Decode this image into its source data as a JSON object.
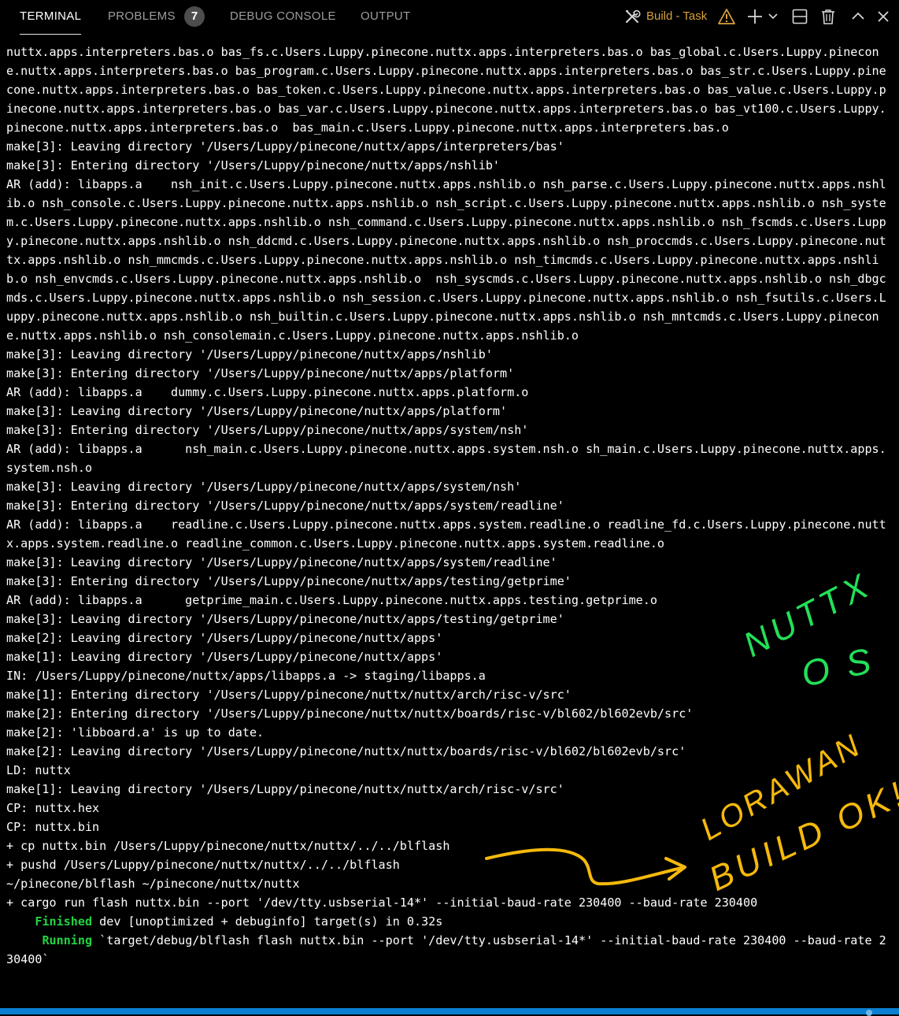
{
  "tabs": [
    {
      "label": "TERMINAL",
      "active": true
    },
    {
      "label": "PROBLEMS"
    },
    {
      "label": "DEBUG CONSOLE"
    },
    {
      "label": "OUTPUT"
    }
  ],
  "problems_count": "7",
  "task_label": "Build - Task",
  "icons": [
    "tools-icon",
    "warning-icon",
    "plus-icon",
    "chevron-down-icon",
    "split-icon",
    "trash-icon",
    "chevron-up-icon",
    "close-icon"
  ],
  "colors": {
    "background": "#000000",
    "text": "#ffffff",
    "tab_inactive": "#9d9d9d",
    "task": "#d6a23a",
    "highlight": "#22d342",
    "annotation_green": "#23e058",
    "annotation_yellow": "#f5b90c",
    "statusbar": "#0b7fd1"
  },
  "terminal": {
    "lines": [
      "nuttx.apps.interpreters.bas.o bas_fs.c.Users.Luppy.pinecone.nuttx.apps.interpreters.bas.o bas_global.c.Users.Luppy.pinecone.nuttx.apps.interpreters.bas.o bas_program.c.Users.Luppy.pinecone.nuttx.apps.interpreters.bas.o bas_str.c.Users.Luppy.pinecone.nuttx.apps.interpreters.bas.o bas_token.c.Users.Luppy.pinecone.nuttx.apps.interpreters.bas.o bas_value.c.Users.Luppy.pinecone.nuttx.apps.interpreters.bas.o bas_var.c.Users.Luppy.pinecone.nuttx.apps.interpreters.bas.o bas_vt100.c.Users.Luppy.pinecone.nuttx.apps.interpreters.bas.o  bas_main.c.Users.Luppy.pinecone.nuttx.apps.interpreters.bas.o",
      "make[3]: Leaving directory '/Users/Luppy/pinecone/nuttx/apps/interpreters/bas'",
      "make[3]: Entering directory '/Users/Luppy/pinecone/nuttx/apps/nshlib'",
      "AR (add): libapps.a    nsh_init.c.Users.Luppy.pinecone.nuttx.apps.nshlib.o nsh_parse.c.Users.Luppy.pinecone.nuttx.apps.nshlib.o nsh_console.c.Users.Luppy.pinecone.nuttx.apps.nshlib.o nsh_script.c.Users.Luppy.pinecone.nuttx.apps.nshlib.o nsh_system.c.Users.Luppy.pinecone.nuttx.apps.nshlib.o nsh_command.c.Users.Luppy.pinecone.nuttx.apps.nshlib.o nsh_fscmds.c.Users.Luppy.pinecone.nuttx.apps.nshlib.o nsh_ddcmd.c.Users.Luppy.pinecone.nuttx.apps.nshlib.o nsh_proccmds.c.Users.Luppy.pinecone.nuttx.apps.nshlib.o nsh_mmcmds.c.Users.Luppy.pinecone.nuttx.apps.nshlib.o nsh_timcmds.c.Users.Luppy.pinecone.nuttx.apps.nshlib.o nsh_envcmds.c.Users.Luppy.pinecone.nuttx.apps.nshlib.o  nsh_syscmds.c.Users.Luppy.pinecone.nuttx.apps.nshlib.o nsh_dbgcmds.c.Users.Luppy.pinecone.nuttx.apps.nshlib.o nsh_session.c.Users.Luppy.pinecone.nuttx.apps.nshlib.o nsh_fsutils.c.Users.Luppy.pinecone.nuttx.apps.nshlib.o nsh_builtin.c.Users.Luppy.pinecone.nuttx.apps.nshlib.o nsh_mntcmds.c.Users.Luppy.pinecone.nuttx.apps.nshlib.o nsh_consolemain.c.Users.Luppy.pinecone.nuttx.apps.nshlib.o",
      "make[3]: Leaving directory '/Users/Luppy/pinecone/nuttx/apps/nshlib'",
      "make[3]: Entering directory '/Users/Luppy/pinecone/nuttx/apps/platform'",
      "AR (add): libapps.a    dummy.c.Users.Luppy.pinecone.nuttx.apps.platform.o",
      "make[3]: Leaving directory '/Users/Luppy/pinecone/nuttx/apps/platform'",
      "make[3]: Entering directory '/Users/Luppy/pinecone/nuttx/apps/system/nsh'",
      "AR (add): libapps.a      nsh_main.c.Users.Luppy.pinecone.nuttx.apps.system.nsh.o sh_main.c.Users.Luppy.pinecone.nuttx.apps.system.nsh.o",
      "make[3]: Leaving directory '/Users/Luppy/pinecone/nuttx/apps/system/nsh'",
      "make[3]: Entering directory '/Users/Luppy/pinecone/nuttx/apps/system/readline'",
      "AR (add): libapps.a    readline.c.Users.Luppy.pinecone.nuttx.apps.system.readline.o readline_fd.c.Users.Luppy.pinecone.nuttx.apps.system.readline.o readline_common.c.Users.Luppy.pinecone.nuttx.apps.system.readline.o",
      "make[3]: Leaving directory '/Users/Luppy/pinecone/nuttx/apps/system/readline'",
      "make[3]: Entering directory '/Users/Luppy/pinecone/nuttx/apps/testing/getprime'",
      "AR (add): libapps.a      getprime_main.c.Users.Luppy.pinecone.nuttx.apps.testing.getprime.o",
      "make[3]: Leaving directory '/Users/Luppy/pinecone/nuttx/apps/testing/getprime'",
      "make[2]: Leaving directory '/Users/Luppy/pinecone/nuttx/apps'",
      "make[1]: Leaving directory '/Users/Luppy/pinecone/nuttx/apps'",
      "IN: /Users/Luppy/pinecone/nuttx/apps/libapps.a -> staging/libapps.a",
      "make[1]: Entering directory '/Users/Luppy/pinecone/nuttx/nuttx/arch/risc-v/src'",
      "make[2]: Entering directory '/Users/Luppy/pinecone/nuttx/nuttx/boards/risc-v/bl602/bl602evb/src'",
      "make[2]: 'libboard.a' is up to date.",
      "make[2]: Leaving directory '/Users/Luppy/pinecone/nuttx/nuttx/boards/risc-v/bl602/bl602evb/src'",
      "LD: nuttx",
      "make[1]: Leaving directory '/Users/Luppy/pinecone/nuttx/nuttx/arch/risc-v/src'",
      "CP: nuttx.hex",
      "CP: nuttx.bin",
      "+ cp nuttx.bin /Users/Luppy/pinecone/nuttx/nuttx/../../blflash",
      "+ pushd /Users/Luppy/pinecone/nuttx/nuttx/../../blflash",
      "~/pinecone/blflash ~/pinecone/nuttx/nuttx",
      "+ cargo run flash nuttx.bin --port '/dev/tty.usbserial-14*' --initial-baud-rate 230400 --baud-rate 230400"
    ],
    "finished": {
      "prefix": "    ",
      "keyword": "Finished",
      "rest": " dev [unoptimized + debuginfo] target(s) in 0.32s"
    },
    "running": {
      "prefix": "     ",
      "keyword": "Running",
      "rest": " `target/debug/blflash flash nuttx.bin --port '/dev/tty.usbserial-14*' --initial-baud-rate 230400 --baud-rate 230400`"
    }
  },
  "annotations": {
    "nuttx_os": [
      "NUTTX",
      "OS"
    ],
    "lorawan_build_ok": [
      "LORAWAN",
      "BUILD OK!"
    ]
  }
}
